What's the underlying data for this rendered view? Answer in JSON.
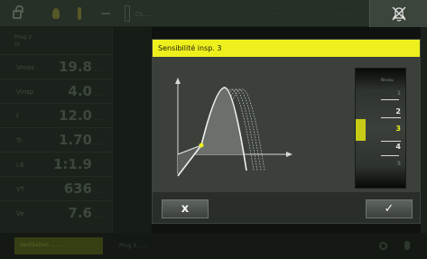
{
  "toolbar": {
    "battery_label": "Ch.....",
    "status_left": "···",
    "status_right": "·····  ·····",
    "right_icon": "no-alarm-icon"
  },
  "sidebar": {
    "program_label": "Prog 2",
    "program_sub": "ct",
    "params": [
      {
        "label": "Vmax",
        "value": "19.8",
        "unit": "......"
      },
      {
        "label": "Vinsp",
        "value": "4.0",
        "unit": "......"
      },
      {
        "label": "f",
        "value": "12.0",
        "unit": "......"
      },
      {
        "label": "Ti",
        "value": "1.70",
        "unit": "......"
      },
      {
        "label": "I:E",
        "value": "1:1.9",
        "unit": ""
      },
      {
        "label": "VT",
        "value": "636",
        "unit": "..."
      },
      {
        "label": "Ve",
        "value": "7.6",
        "unit": "......"
      }
    ]
  },
  "bottom": {
    "active_tab": "Ventilation .......",
    "text": "Prog 3  ......"
  },
  "dialog": {
    "title": "Sensibilité insp. 3",
    "selector": {
      "header": "Niveau",
      "values": [
        "1",
        "2",
        "3",
        "4",
        "5"
      ],
      "selected": "3"
    },
    "cancel_label": "x",
    "ok_label": "✓"
  },
  "colors": {
    "accent": "#eef01e",
    "background": "#0f120f",
    "dialog_bg": "#3b403b"
  }
}
